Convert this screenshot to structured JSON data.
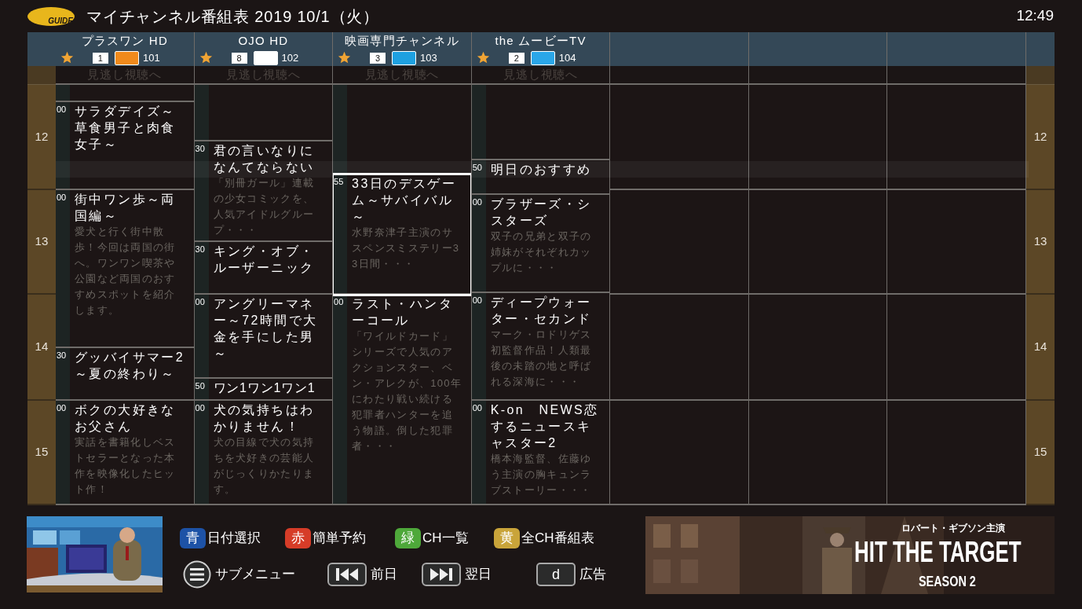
{
  "header": {
    "logo": "GUIDE",
    "title": "マイチャンネル番組表 2019 10/1（火）",
    "time": "12:49"
  },
  "channels": [
    {
      "name": "プラスワン HD",
      "favorite": true,
      "number": "1",
      "code": "101",
      "catchup": "見逃し視聴へ",
      "programs": [
        {
          "minute": "00",
          "title": "サラダデイズ～草食男子と肉食女子～",
          "selected": false
        },
        {
          "minute": "00",
          "title": "街中ワン歩～両国編～",
          "description": "愛犬と行く街中散歩！今回は両国の街へ。ワンワン喫茶や公園など両国のおすすめスポットを紹介します。",
          "selected": false
        },
        {
          "minute": "30",
          "title": "グッバイサマー2～夏の終わり～",
          "selected": false
        },
        {
          "minute": "00",
          "title": "ボクの大好きなお父さん",
          "description": "実話を書籍化しベストセラーとなった本作を映像化したヒット作！",
          "selected": false
        }
      ]
    },
    {
      "name": "OJO HD",
      "favorite": true,
      "number": "8",
      "code": "102",
      "catchup": "見逃し視聴へ",
      "programs": [
        {
          "minute": "30",
          "title": "君の言いなりになんてならない",
          "description": "「別冊ガール」連載の少女コミックを、人気アイドルグループ・・・",
          "selected": false
        },
        {
          "minute": "30",
          "title": "キング・オブ・ルーザーニック",
          "selected": false
        },
        {
          "minute": "00",
          "title": "アングリーマネー～72時間で大金を手にした男～",
          "selected": false
        },
        {
          "minute": "50",
          "title": "ワン1ワン1ワン1",
          "selected": false
        },
        {
          "minute": "00",
          "title": "犬の気持ちはわかりません！",
          "description": "犬の目線で犬の気持ちを犬好きの芸能人がじっくりかたります。",
          "selected": false
        }
      ]
    },
    {
      "name": "映画専門チャンネル",
      "favorite": true,
      "number": "3",
      "code": "103",
      "catchup": "見逃し視聴へ",
      "programs": [
        {
          "minute": "55",
          "title": "33日のデスゲーム～サバイバル～",
          "description": "水野奈津子主演のサスペンスミステリー33日間・・・",
          "selected": true
        },
        {
          "minute": "00",
          "title": "ラスト・ハンターコール",
          "description": "「ワイルドカード」シリーズで人気のアクションスター、ベン・アレクが、100年にわたり戦い続ける犯罪者ハンターを追う物語。倒した犯罪者・・・",
          "selected": false
        }
      ]
    },
    {
      "name": "the ムービーTV",
      "favorite": true,
      "number": "2",
      "code": "104",
      "catchup": "見逃し視聴へ",
      "programs": [
        {
          "minute": "50",
          "title": "明日のおすすめ",
          "selected": false
        },
        {
          "minute": "00",
          "title": "ブラザーズ・シスターズ",
          "description": "双子の兄弟と双子の姉妹がそれぞれカップルに・・・",
          "selected": false
        },
        {
          "minute": "00",
          "title": "ディープウォーター・セカンド",
          "description": "マーク・ロドリゲス初監督作品！人類最後の未踏の地と呼ばれる深海に・・・",
          "selected": false
        },
        {
          "minute": "00",
          "title": "K-on　NEWS恋するニュースキャスター2",
          "description": "橋本海監督、佐藤ゆう主演の胸キュンラブストーリー・・・",
          "selected": false
        }
      ]
    }
  ],
  "left_hours": [
    "12",
    "13",
    "14",
    "15"
  ],
  "right_hours": [
    "12",
    "13",
    "14",
    "15"
  ],
  "color_buttons": [
    {
      "key": "青",
      "label": "日付選択",
      "color": "#1d52a6"
    },
    {
      "key": "赤",
      "label": "簡単予約",
      "color": "#d63c28"
    },
    {
      "key": "緑",
      "label": "CH一覧",
      "color": "#4ea83a"
    },
    {
      "key": "黄",
      "label": "全CH番組表",
      "color": "#c9a43a"
    }
  ],
  "nav_buttons": [
    {
      "kind": "menu",
      "label": "サブメニュー"
    },
    {
      "kind": "prev",
      "label": "前日"
    },
    {
      "kind": "next",
      "label": "翌日"
    },
    {
      "kind": "key",
      "key": "d",
      "label": "広告"
    }
  ],
  "ad": {
    "kind": "picture",
    "tagline": "ロバート・ギブソン主演",
    "headline": "HIT THE TARGET",
    "subtitle": "SEASON 2"
  }
}
